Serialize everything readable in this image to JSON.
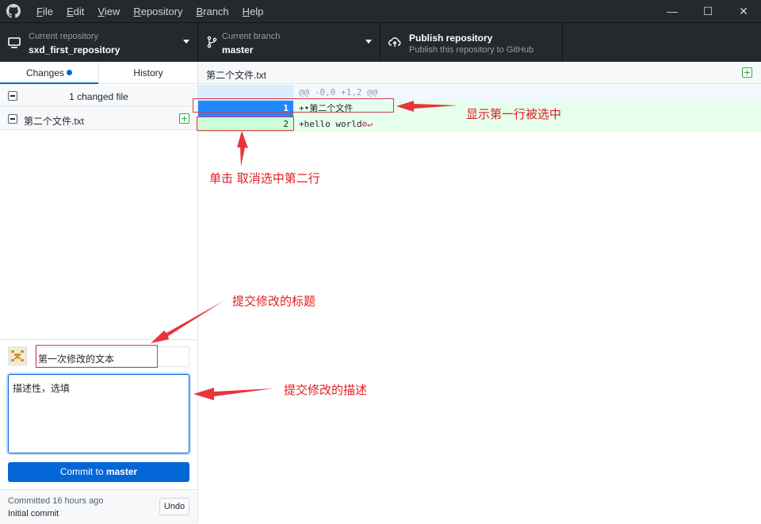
{
  "menu": {
    "items": [
      {
        "label": "File",
        "key": "F",
        "rest": "ile"
      },
      {
        "label": "Edit",
        "key": "E",
        "rest": "dit"
      },
      {
        "label": "View",
        "key": "V",
        "rest": "iew"
      },
      {
        "label": "Repository",
        "key": "R",
        "rest": "epository"
      },
      {
        "label": "Branch",
        "key": "B",
        "rest": "ranch"
      },
      {
        "label": "Help",
        "key": "H",
        "rest": "elp"
      }
    ]
  },
  "toolbar": {
    "repo_label": "Current repository",
    "repo_value": "sxd_first_repository",
    "branch_label": "Current branch",
    "branch_value": "master",
    "publish_title": "Publish repository",
    "publish_sub": "Publish this repository to GitHub"
  },
  "tabs": {
    "changes": "Changes",
    "history": "History"
  },
  "changes": {
    "summary": "1 changed file",
    "files": [
      {
        "name": "第二个文件.txt"
      }
    ]
  },
  "commit": {
    "summary_value": "第一次修改的文本",
    "description_value": "描述性，选填",
    "button_prefix": "Commit to ",
    "button_branch": "master",
    "last_commit_time": "Committed 16 hours ago",
    "last_commit_msg": "Initial commit",
    "undo_label": "Undo"
  },
  "diff": {
    "filename": "第二个文件.txt",
    "hunk": "@@ -0,0 +1,2 @@",
    "lines": [
      {
        "num": "1",
        "text": "+•第二个文件",
        "selected": true
      },
      {
        "num": "2",
        "text": "+hello world",
        "selected": false
      }
    ]
  },
  "annotations": {
    "line_selected": "显示第一行被选中",
    "click_deselect": "单击  取消选中第二行",
    "commit_title": "提交修改的标题",
    "commit_desc": "提交修改的描述"
  },
  "colors": {
    "accent": "#0366d6",
    "selected_line": "#2188ff",
    "annotation_red": "#e11d21"
  }
}
